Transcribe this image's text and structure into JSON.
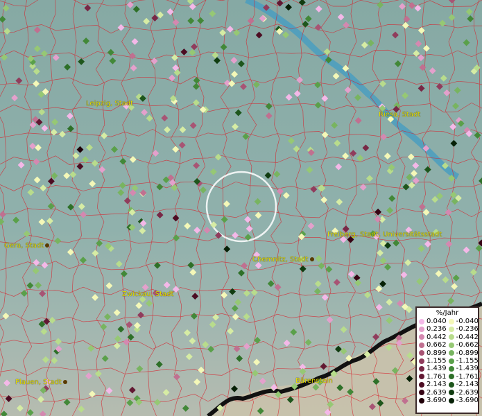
{
  "cities": [
    {
      "name": "Leipzig, Stadt"
    },
    {
      "name": "Riesa, Stadt"
    },
    {
      "name": "Gera, Stadt"
    },
    {
      "name": "Freiberg, Stadt, Universitätsstadt"
    },
    {
      "name": "Chemnitz, Stadt"
    },
    {
      "name": "Zwickau, Stadt"
    },
    {
      "name": "Plauen, Stadt"
    },
    {
      "name": "Bärenstein"
    }
  ],
  "legend": {
    "title": "%/Jahr",
    "positive": [
      {
        "label": "0.040",
        "color": "#f4b8e8"
      },
      {
        "label": "0.236",
        "color": "#e4a0cc"
      },
      {
        "label": "0.442",
        "color": "#d488b0"
      },
      {
        "label": "0.662",
        "color": "#c07090"
      },
      {
        "label": "0.899",
        "color": "#a85474"
      },
      {
        "label": "1.155",
        "color": "#903c5c"
      },
      {
        "label": "1.439",
        "color": "#782846"
      },
      {
        "label": "1.761",
        "color": "#621832"
      },
      {
        "label": "2.143",
        "color": "#4c0c22"
      },
      {
        "label": "2.639",
        "color": "#360414"
      },
      {
        "label": "3.690",
        "color": "#200008"
      }
    ],
    "negative": [
      {
        "label": "-0.040",
        "color": "#f4f8b8"
      },
      {
        "label": "-0.236",
        "color": "#d6eca4"
      },
      {
        "label": "-0.442",
        "color": "#b8dc8c"
      },
      {
        "label": "-0.662",
        "color": "#96c874"
      },
      {
        "label": "-0.899",
        "color": "#78b460"
      },
      {
        "label": "-1.155",
        "color": "#5aa04a"
      },
      {
        "label": "-1.439",
        "color": "#428838"
      },
      {
        "label": "-1.761",
        "color": "#2e7028"
      },
      {
        "label": "-2.143",
        "color": "#1e561c"
      },
      {
        "label": "-2.639",
        "color": "#103c10"
      },
      {
        "label": "-3.690",
        "color": "#062006"
      }
    ]
  }
}
